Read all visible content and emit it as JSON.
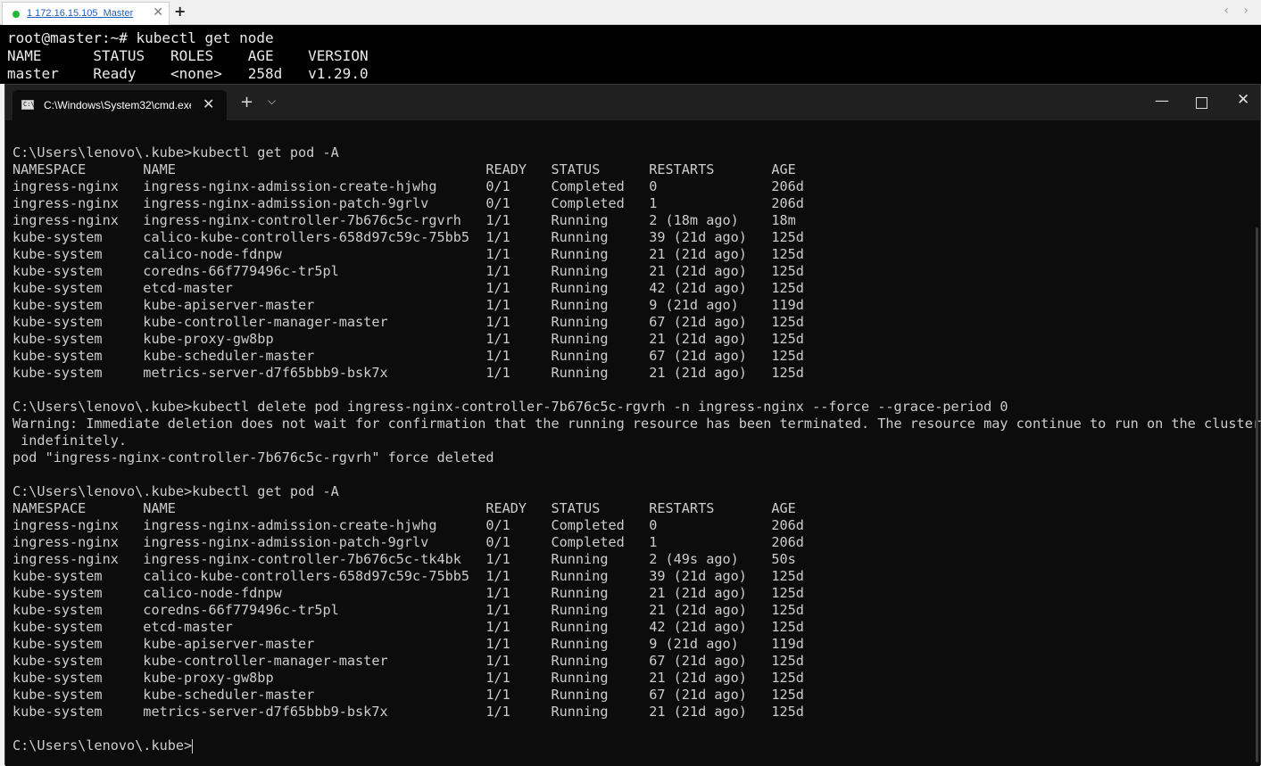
{
  "ssh_window": {
    "tab_label": "1 172.16.15.105_Master",
    "close_glyph": "✕",
    "new_tab_glyph": "+",
    "nav_arrows": "‹ ›",
    "lines": [
      "root@master:~# kubectl get node",
      "NAME      STATUS   ROLES    AGE    VERSION",
      "master    Ready    <none>   258d   v1.29.0"
    ]
  },
  "terminal_window": {
    "tab_label": "C:\\Windows\\System32\\cmd.exe",
    "tab_icon_text": "C:\\",
    "tab_close_glyph": "✕",
    "new_tab_glyph": "+",
    "dropdown_glyph": "⌵",
    "minimize_glyph": "—",
    "close_glyph": "✕",
    "lines": [
      "C:\\Users\\lenovo\\.kube>kubectl get pod -A",
      "NAMESPACE       NAME                                      READY   STATUS      RESTARTS       AGE",
      "ingress-nginx   ingress-nginx-admission-create-hjwhg      0/1     Completed   0              206d",
      "ingress-nginx   ingress-nginx-admission-patch-9grlv       0/1     Completed   1              206d",
      "ingress-nginx   ingress-nginx-controller-7b676c5c-rgvrh   1/1     Running     2 (18m ago)    18m",
      "kube-system     calico-kube-controllers-658d97c59c-75bb5  1/1     Running     39 (21d ago)   125d",
      "kube-system     calico-node-fdnpw                         1/1     Running     21 (21d ago)   125d",
      "kube-system     coredns-66f779496c-tr5pl                  1/1     Running     21 (21d ago)   125d",
      "kube-system     etcd-master                               1/1     Running     42 (21d ago)   125d",
      "kube-system     kube-apiserver-master                     1/1     Running     9 (21d ago)    119d",
      "kube-system     kube-controller-manager-master            1/1     Running     67 (21d ago)   125d",
      "kube-system     kube-proxy-gw8bp                          1/1     Running     21 (21d ago)   125d",
      "kube-system     kube-scheduler-master                     1/1     Running     67 (21d ago)   125d",
      "kube-system     metrics-server-d7f65bbb9-bsk7x            1/1     Running     21 (21d ago)   125d",
      "",
      "C:\\Users\\lenovo\\.kube>kubectl delete pod ingress-nginx-controller-7b676c5c-rgvrh -n ingress-nginx --force --grace-period 0",
      "Warning: Immediate deletion does not wait for confirmation that the running resource has been terminated. The resource may continue to run on the cluster",
      " indefinitely.",
      "pod \"ingress-nginx-controller-7b676c5c-rgvrh\" force deleted",
      "",
      "C:\\Users\\lenovo\\.kube>kubectl get pod -A",
      "NAMESPACE       NAME                                      READY   STATUS      RESTARTS       AGE",
      "ingress-nginx   ingress-nginx-admission-create-hjwhg      0/1     Completed   0              206d",
      "ingress-nginx   ingress-nginx-admission-patch-9grlv       0/1     Completed   1              206d",
      "ingress-nginx   ingress-nginx-controller-7b676c5c-tk4bk   1/1     Running     2 (49s ago)    50s",
      "kube-system     calico-kube-controllers-658d97c59c-75bb5  1/1     Running     39 (21d ago)   125d",
      "kube-system     calico-node-fdnpw                         1/1     Running     21 (21d ago)   125d",
      "kube-system     coredns-66f779496c-tr5pl                  1/1     Running     21 (21d ago)   125d",
      "kube-system     etcd-master                               1/1     Running     42 (21d ago)   125d",
      "kube-system     kube-apiserver-master                     1/1     Running     9 (21d ago)    119d",
      "kube-system     kube-controller-manager-master            1/1     Running     67 (21d ago)   125d",
      "kube-system     kube-proxy-gw8bp                          1/1     Running     21 (21d ago)   125d",
      "kube-system     kube-scheduler-master                     1/1     Running     67 (21d ago)   125d",
      "kube-system     metrics-server-d7f65bbb9-bsk7x            1/1     Running     21 (21d ago)   125d",
      ""
    ],
    "prompt": "C:\\Users\\lenovo\\.kube>"
  },
  "colors": {
    "terminal_bg": "#0c0c0c",
    "terminal_fg": "#cccccc",
    "titlebar_bg": "#202020",
    "ssh_status_dot": "#1fba3a"
  }
}
